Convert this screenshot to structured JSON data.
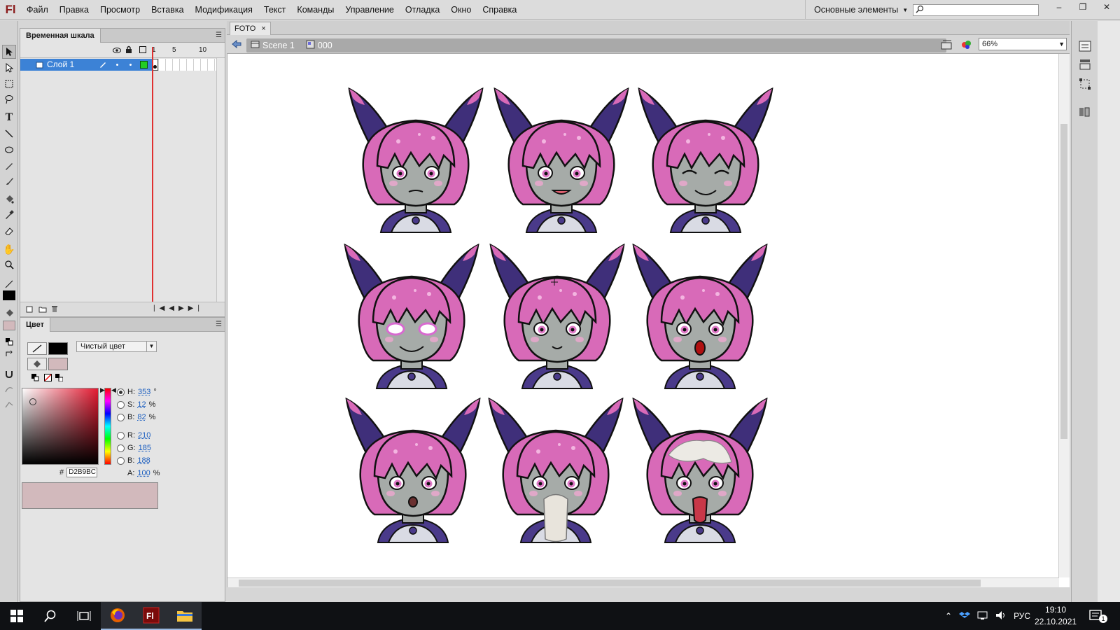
{
  "app": {
    "logo": "Fl",
    "menu": [
      "Файл",
      "Правка",
      "Просмотр",
      "Вставка",
      "Модификация",
      "Текст",
      "Команды",
      "Управление",
      "Отладка",
      "Окно",
      "Справка"
    ],
    "workspace": "Основные элементы",
    "window_controls": [
      "–",
      "❐",
      "✕"
    ]
  },
  "timeline": {
    "tab_label": "Временная шкала",
    "layer_name": "Слой 1",
    "ruler": [
      "1",
      "5",
      "10"
    ]
  },
  "color_panel": {
    "tab_label": "Цвет",
    "fill_type": "Чистый цвет",
    "fields": {
      "H": {
        "label": "H:",
        "value": "353",
        "unit": "°"
      },
      "S": {
        "label": "S:",
        "value": "12",
        "unit": "%"
      },
      "B": {
        "label": "B:",
        "value": "82",
        "unit": "%"
      },
      "R": {
        "label": "R:",
        "value": "210",
        "unit": ""
      },
      "G": {
        "label": "G:",
        "value": "185",
        "unit": ""
      },
      "Bl": {
        "label": "B:",
        "value": "188",
        "unit": ""
      },
      "A": {
        "label": "A:",
        "value": "100",
        "unit": "%"
      }
    },
    "hex_label": "#",
    "hex": "D2B9BC",
    "fill_color": "#d2b9bc",
    "stroke_color": "#000000"
  },
  "document": {
    "tab_label": "FOTO",
    "tab_close": "×",
    "scene": "Scene 1",
    "symbol": "000",
    "zoom": "66%"
  },
  "stage": {
    "character_count": 9,
    "colors": {
      "hair": "#d86ab8",
      "horn": "#3f2f7a",
      "skin": "#a6aba8",
      "eye": "#e07ac8",
      "collar": "#4a3a8a"
    }
  },
  "taskbar": {
    "lang": "РУС",
    "time": "19:10",
    "date": "22.10.2021",
    "notification_count": "1"
  }
}
